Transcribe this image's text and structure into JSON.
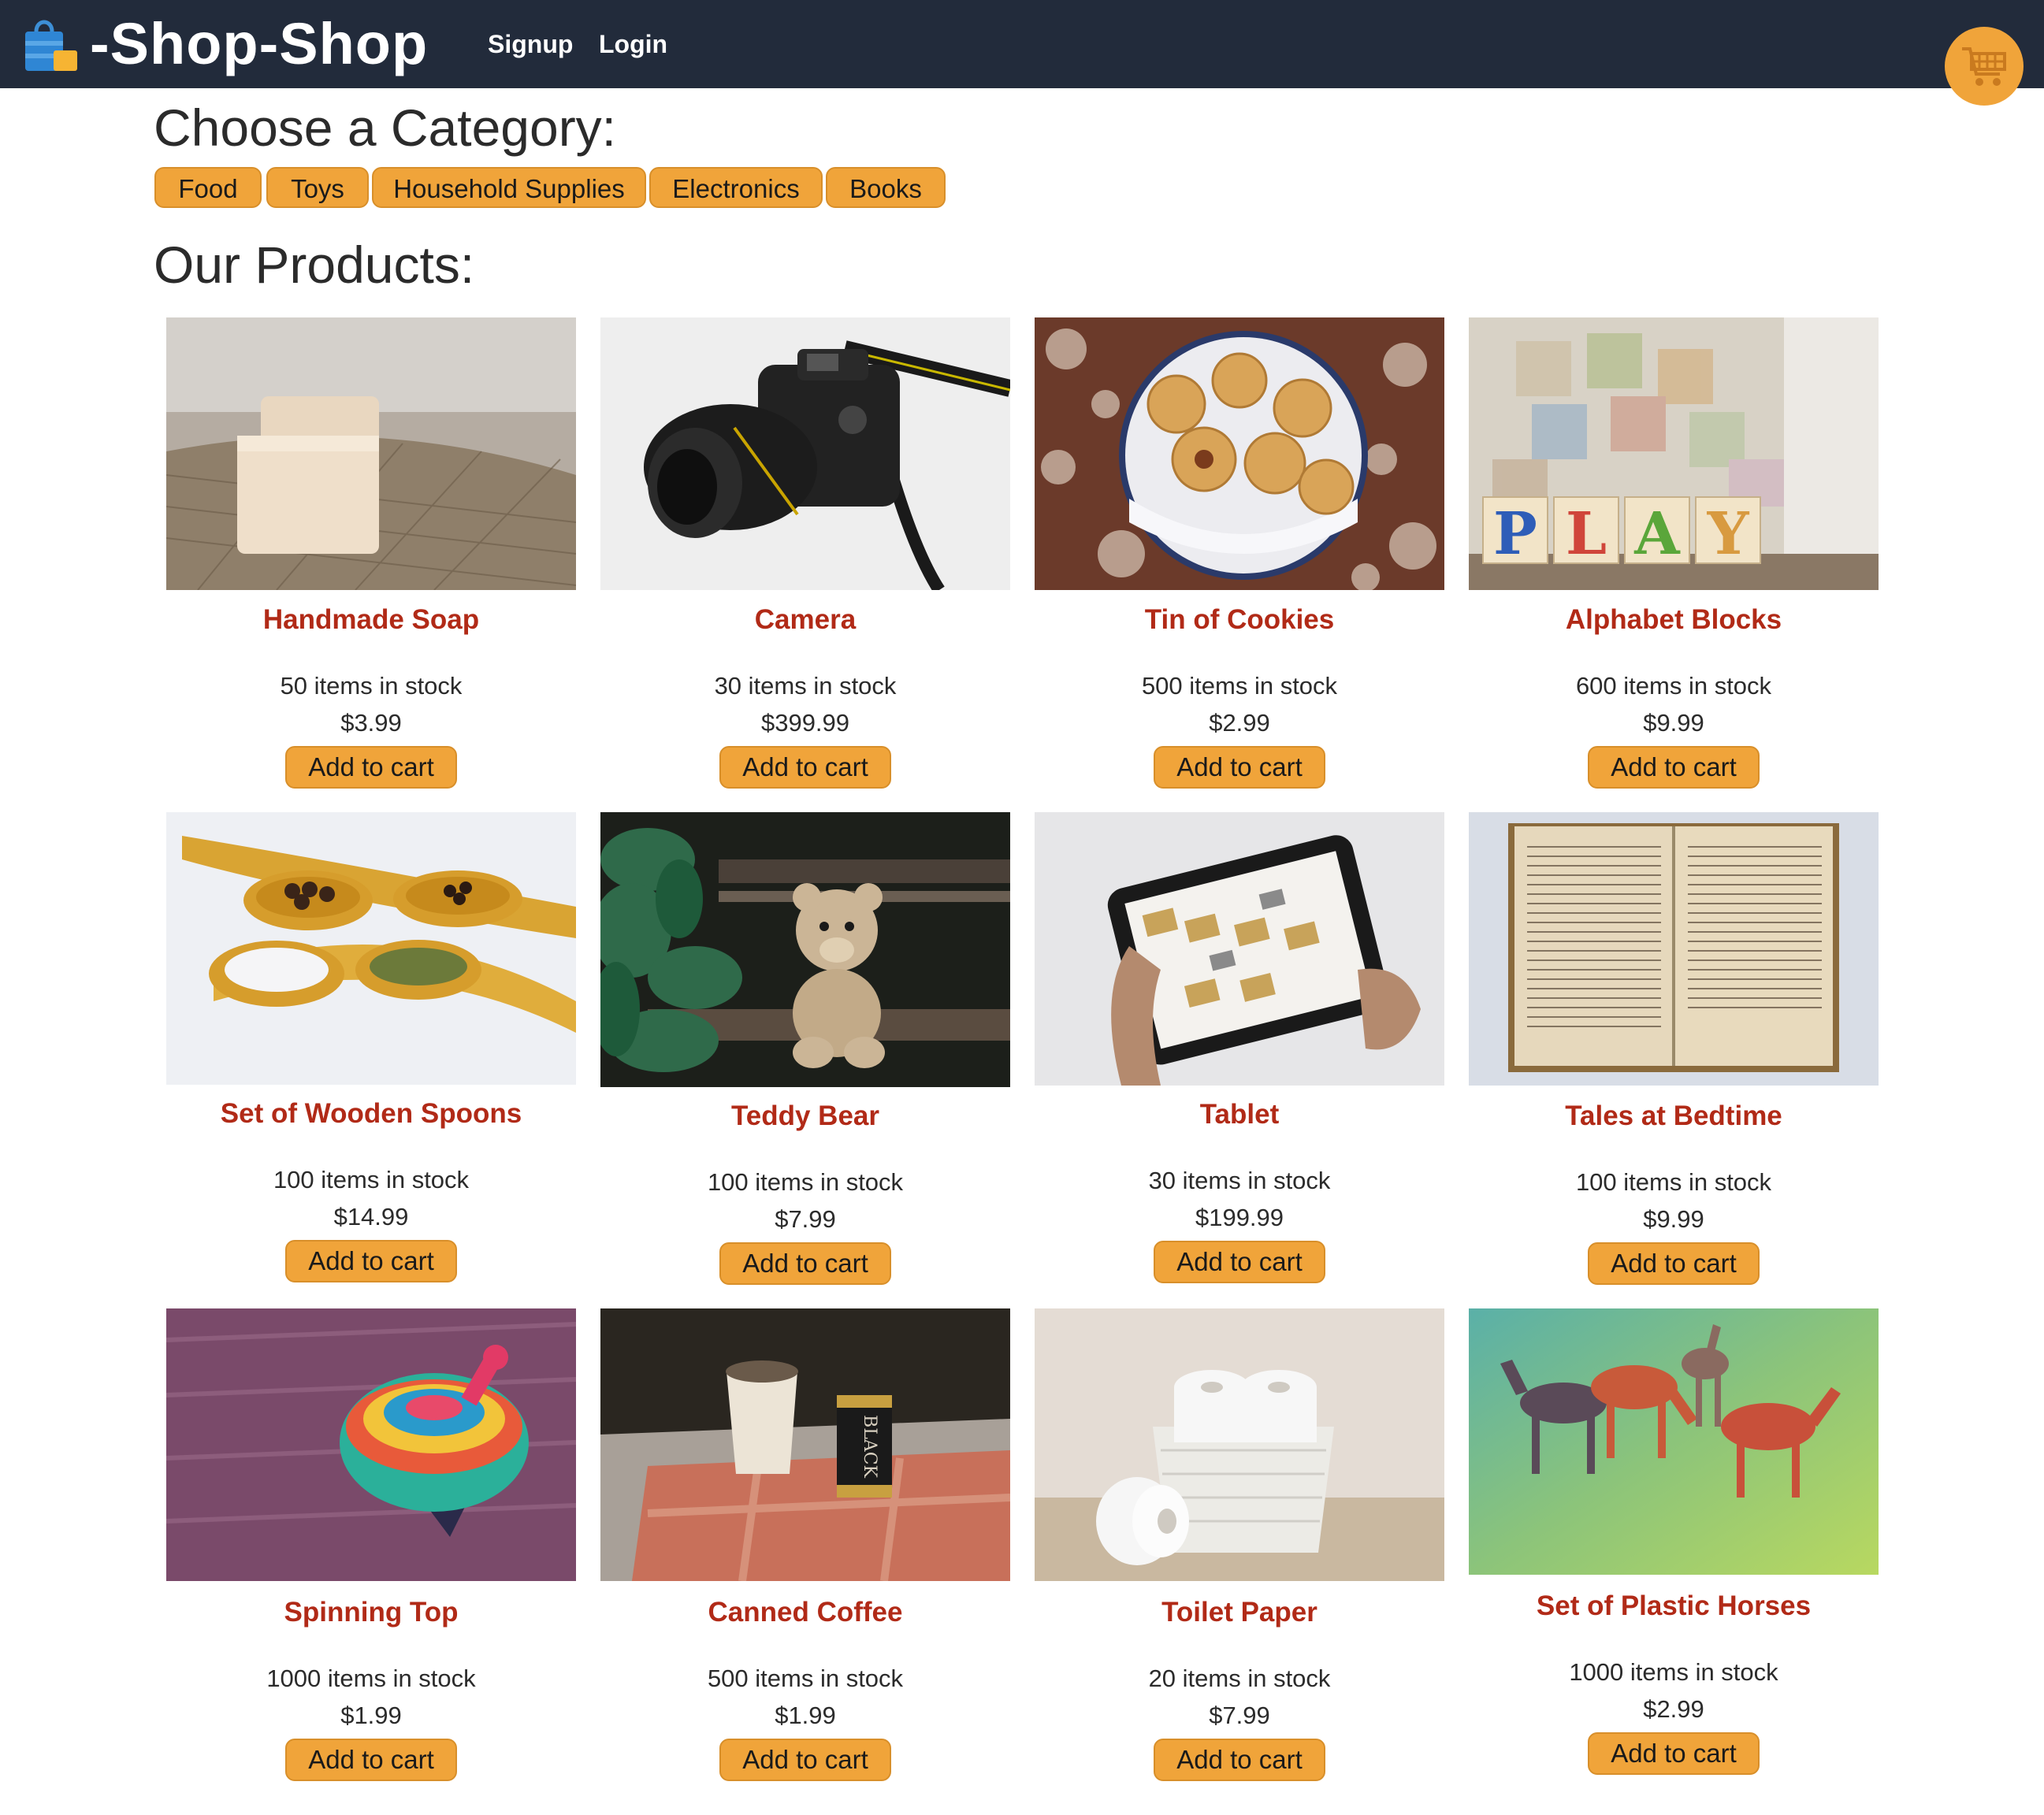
{
  "header": {
    "brand": "-Shop-Shop",
    "logo_icon": "shopping-bag-icon",
    "links": [
      {
        "label": "Signup"
      },
      {
        "label": "Login"
      }
    ],
    "cart_icon": "shopping-cart-icon"
  },
  "categories": {
    "title": "Choose a Category:",
    "items": [
      {
        "label": "Food"
      },
      {
        "label": "Toys"
      },
      {
        "label": "Household Supplies"
      },
      {
        "label": "Electronics"
      },
      {
        "label": "Books"
      }
    ]
  },
  "products": {
    "title": "Our Products:",
    "add_label": "Add to cart",
    "items": [
      {
        "name": "Handmade Soap",
        "stock": "50 items in stock",
        "price": "$3.99"
      },
      {
        "name": "Camera",
        "stock": "30 items in stock",
        "price": "$399.99"
      },
      {
        "name": "Tin of Cookies",
        "stock": "500 items in stock",
        "price": "$2.99"
      },
      {
        "name": "Alphabet Blocks",
        "stock": "600 items in stock",
        "price": "$9.99"
      },
      {
        "name": "Set of Wooden Spoons",
        "stock": "100 items in stock",
        "price": "$14.99"
      },
      {
        "name": "Teddy Bear",
        "stock": "100 items in stock",
        "price": "$7.99"
      },
      {
        "name": "Tablet",
        "stock": "30 items in stock",
        "price": "$199.99"
      },
      {
        "name": "Tales at Bedtime",
        "stock": "100 items in stock",
        "price": "$9.99"
      },
      {
        "name": "Spinning Top",
        "stock": "1000 items in stock",
        "price": "$1.99"
      },
      {
        "name": "Canned Coffee",
        "stock": "500 items in stock",
        "price": "$1.99"
      },
      {
        "name": "Toilet Paper",
        "stock": "20 items in stock",
        "price": "$7.99"
      },
      {
        "name": "Set of Plastic Horses",
        "stock": "1000 items in stock",
        "price": "$2.99"
      }
    ]
  },
  "colors": {
    "nav_bg": "#222b3b",
    "accent": "#f0a43a",
    "product_name": "#b12a17"
  }
}
